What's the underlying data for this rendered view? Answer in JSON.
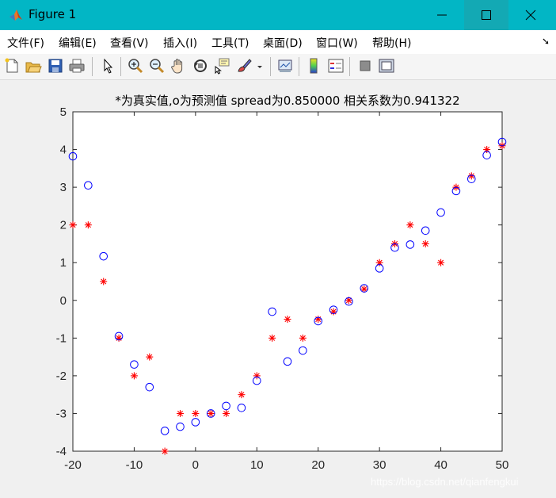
{
  "window": {
    "title": "Figure 1"
  },
  "menu": [
    {
      "label": "文件(F)"
    },
    {
      "label": "编辑(E)"
    },
    {
      "label": "查看(V)"
    },
    {
      "label": "插入(I)"
    },
    {
      "label": "工具(T)"
    },
    {
      "label": "桌面(D)"
    },
    {
      "label": "窗口(W)"
    },
    {
      "label": "帮助(H)"
    }
  ],
  "toolbar": {
    "icons": [
      "new-figure-icon",
      "open-file-icon",
      "save-icon",
      "print-icon",
      "edit-plot-arrow-icon",
      "zoom-in-icon",
      "zoom-out-icon",
      "pan-hand-icon",
      "rotate-3d-icon",
      "data-cursor-icon",
      "brush-icon",
      "link-plot-icon",
      "colorbar-icon",
      "legend-icon",
      "hide-plot-tools-icon",
      "show-plot-tools-icon"
    ]
  },
  "colors": {
    "titlebar": "#02b6c5",
    "actual": "#ff0000",
    "predicted": "#0000ff"
  },
  "watermark": "https://blog.csdn.net/qianfengkui",
  "chart_data": {
    "type": "scatter",
    "title": "*为真实值,o为预测值 spread为0.850000 相关系数为0.941322",
    "xlabel": "",
    "ylabel": "",
    "xlim": [
      -20,
      50
    ],
    "ylim": [
      -4,
      5
    ],
    "xticks": [
      -20,
      -10,
      0,
      10,
      20,
      30,
      40,
      50
    ],
    "yticks": [
      -4,
      -3,
      -2,
      -1,
      0,
      1,
      2,
      3,
      4,
      5
    ],
    "grid": false,
    "legend": "none",
    "x": [
      -20,
      -17.5,
      -15,
      -12.5,
      -10,
      -7.5,
      -5,
      -2.5,
      0,
      2.5,
      5,
      7.5,
      10,
      12.5,
      15,
      17.5,
      20,
      22.5,
      25,
      27.5,
      30,
      32.5,
      35,
      37.5,
      40,
      42.5,
      45,
      47.5,
      50
    ],
    "series": [
      {
        "marker": "*",
        "color": "#ff0000",
        "values": [
          2,
          2,
          0.5,
          -1,
          -2,
          -1.5,
          -4,
          -3,
          -3,
          -3,
          -3,
          -2.5,
          -2,
          -1,
          -0.5,
          -1,
          -0.5,
          -0.3,
          0,
          0.3,
          1,
          1.5,
          2,
          1.5,
          1,
          3,
          3.3,
          4,
          4.1
        ]
      },
      {
        "marker": "o",
        "color": "#0000ff",
        "values": [
          3.82,
          3.05,
          1.17,
          -0.95,
          -1.7,
          -2.3,
          -3.46,
          -3.35,
          -3.23,
          -3.0,
          -2.8,
          -2.85,
          -2.13,
          -0.3,
          -1.62,
          -1.33,
          -0.55,
          -0.25,
          -0.03,
          0.32,
          0.85,
          1.4,
          1.48,
          1.85,
          2.33,
          2.9,
          3.22,
          3.85,
          4.2
        ]
      }
    ]
  }
}
